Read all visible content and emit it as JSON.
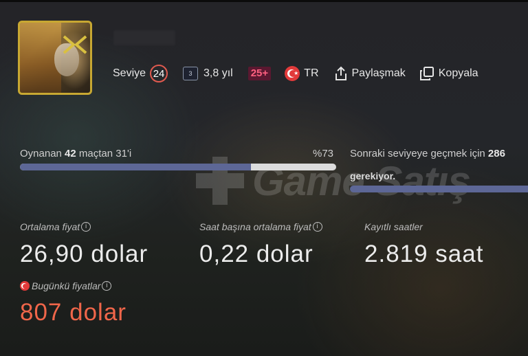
{
  "profile": {
    "level_label": "Seviye",
    "level": "24",
    "years_icon_text": "3",
    "years": "3,8 yıl",
    "age_rating": "25+",
    "region": "TR",
    "share_label": "Paylaşmak",
    "copy_label": "Kopyala"
  },
  "progress": {
    "prefix": "Oynanan ",
    "total_matches": "42",
    "middle": " maçtan ",
    "played": "31'i",
    "percent_label": "%73",
    "fraction": 0.73,
    "next_level_prefix": "Sonraki seviyeye geçmek için ",
    "next_level_value": "286",
    "next_level_suffix": "gerekiyor."
  },
  "watermark": "Game Satış",
  "stats": {
    "avg_price_label": "Ortalama fiyat",
    "avg_price_value": "26,90 dolar",
    "hourly_avg_label": "Saat başına ortalama fiyat",
    "hourly_avg_value": "0,22 dolar",
    "hours_label": "Kayıtlı saatler",
    "hours_value": "2.819 saat",
    "today_label": "Bugünkü fiyatlar",
    "today_value": "807 dolar"
  },
  "colors": {
    "accent": "#f0664a",
    "level_ring": "#e05a4f",
    "progress_fill": "#5d6796",
    "avatar_border": "#c8a832"
  }
}
